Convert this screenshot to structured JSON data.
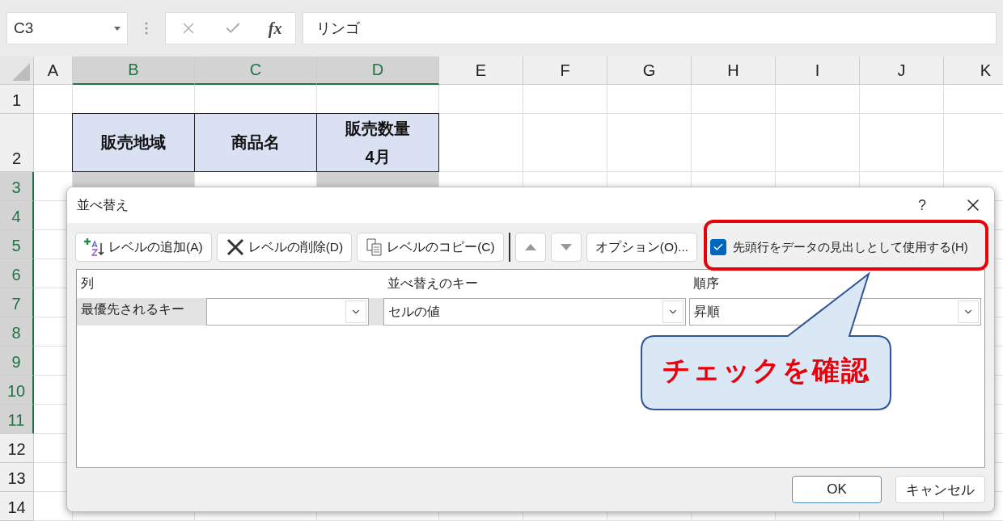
{
  "formula_bar": {
    "name_box": "C3",
    "function_label": "fx",
    "formula": "リンゴ"
  },
  "columns": [
    {
      "label": "A",
      "selected": false
    },
    {
      "label": "B",
      "selected": true
    },
    {
      "label": "C",
      "selected": true
    },
    {
      "label": "D",
      "selected": true
    },
    {
      "label": "E",
      "selected": false
    },
    {
      "label": "F",
      "selected": false
    },
    {
      "label": "G",
      "selected": false
    },
    {
      "label": "H",
      "selected": false
    },
    {
      "label": "I",
      "selected": false
    },
    {
      "label": "J",
      "selected": false
    },
    {
      "label": "K",
      "selected": false
    }
  ],
  "rows": [
    {
      "label": "1",
      "selected": false
    },
    {
      "label": "2",
      "selected": false
    },
    {
      "label": "3",
      "selected": true
    },
    {
      "label": "4",
      "selected": true
    },
    {
      "label": "5",
      "selected": true
    },
    {
      "label": "6",
      "selected": true
    },
    {
      "label": "7",
      "selected": true
    },
    {
      "label": "8",
      "selected": true
    },
    {
      "label": "9",
      "selected": true
    },
    {
      "label": "10",
      "selected": true
    },
    {
      "label": "11",
      "selected": true
    },
    {
      "label": "12",
      "selected": false
    },
    {
      "label": "13",
      "selected": false
    },
    {
      "label": "14",
      "selected": false
    }
  ],
  "table_header": [
    {
      "lines": [
        "販売地域"
      ]
    },
    {
      "lines": [
        "商品名"
      ]
    },
    {
      "lines": [
        "販売数量",
        "4月"
      ]
    }
  ],
  "dialog": {
    "title": "並べ替え",
    "help": "?",
    "toolbar": [
      {
        "kind": "add",
        "label": "レベルの追加(A)"
      },
      {
        "kind": "delete",
        "label": "レベルの削除(D)"
      },
      {
        "kind": "copy",
        "label": "レベルのコピー(C)"
      },
      {
        "kind": "up"
      },
      {
        "kind": "down"
      },
      {
        "kind": "options",
        "label": "オプション(O)..."
      }
    ],
    "header_checkbox": {
      "label": "先頭行をデータの見出しとして使用する(H)",
      "checked": true
    },
    "list_columns": [
      "列",
      "並べ替えのキー",
      "順序"
    ],
    "levels": [
      {
        "label": "最優先されるキー",
        "key": "セルの値",
        "order": "昇順"
      }
    ],
    "buttons": [
      {
        "label": "OK",
        "default": true
      },
      {
        "label": "キャンセル",
        "default": false
      }
    ]
  },
  "annotation": {
    "text": "チェックを確認"
  }
}
